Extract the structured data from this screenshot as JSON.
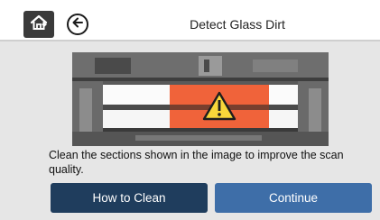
{
  "header": {
    "title": "Detect Glass Dirt",
    "home_icon": "home-icon",
    "back_icon": "back-arrow-icon"
  },
  "illustration": {
    "icon": "warning-triangle-icon",
    "highlight_color": "#f0633a",
    "warning_color": "#f8d63a"
  },
  "message": "Clean the sections shown in the image to improve the scan quality.",
  "buttons": {
    "how_to_clean": "How to Clean",
    "continue": "Continue"
  },
  "colors": {
    "how_to_clean_bg": "#1f3d5d",
    "continue_bg": "#3e6ea8"
  }
}
